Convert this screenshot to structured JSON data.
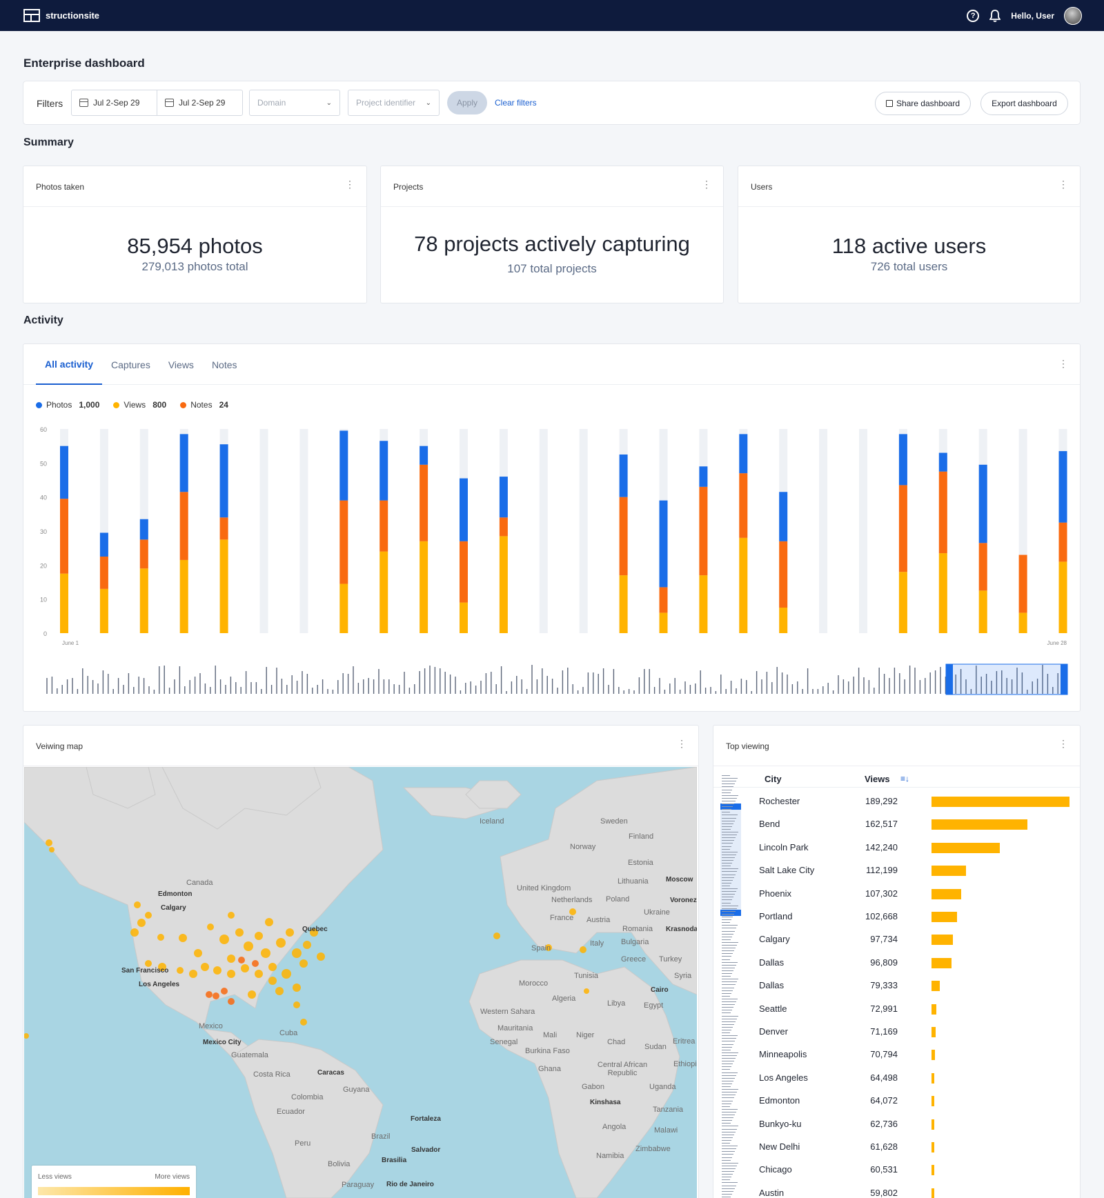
{
  "app": {
    "brand": "structionsite",
    "greeting": "Hello, User",
    "help_icon": "question-circle-icon",
    "bell_icon": "bell-icon"
  },
  "page": {
    "title": "Enterprise dashboard"
  },
  "filters": {
    "label": "Filters",
    "date_from": "Jul 2-Sep 29",
    "date_to": "Jul 2-Sep 29",
    "domain_placeholder": "Domain",
    "project_placeholder": "Project identifier",
    "apply": "Apply",
    "clear": "Clear filters",
    "share": "Share dashboard",
    "export": "Export dashboard"
  },
  "summary": {
    "title": "Summary",
    "cards": [
      {
        "title": "Photos taken",
        "value": "85,954 photos",
        "sub": "279,013 photos total"
      },
      {
        "title": "Projects",
        "value": "78 projects actively capturing",
        "sub": "107 total projects"
      },
      {
        "title": "Users",
        "value": "118 active users",
        "sub": "726 total users"
      }
    ]
  },
  "activity": {
    "title": "Activity",
    "tabs": [
      "All activity",
      "Captures",
      "Views",
      "Notes"
    ],
    "active_tab": "All activity",
    "legend": [
      {
        "name": "Photos",
        "value": "1,000",
        "color": "#1a6de8"
      },
      {
        "name": "Views",
        "value": "800",
        "color": "#ffb300"
      },
      {
        "name": "Notes",
        "value": "24",
        "color": "#f96a10"
      }
    ]
  },
  "chart_data": {
    "type": "bar",
    "stacked": true,
    "y_ticks": [
      "60",
      "50",
      "40",
      "30",
      "20",
      "10",
      "0"
    ],
    "ylim": [
      0,
      60
    ],
    "x_labels": [
      "June 1",
      "June 28"
    ],
    "colors": {
      "Views": "#ffb300",
      "Notes": "#f96a10",
      "Photos": "#1a6de8",
      "empty": "#eef1f5"
    },
    "series": [
      {
        "name": "Views",
        "values": [
          17.5,
          13,
          19,
          21.5,
          27.5,
          0,
          0,
          14.5,
          24,
          27,
          9,
          28.5,
          0,
          0,
          17,
          6,
          17,
          28,
          7.5,
          0,
          0,
          18,
          23.5,
          12.5,
          6,
          21
        ]
      },
      {
        "name": "Notes",
        "values": [
          22,
          9.5,
          8.5,
          20,
          6.5,
          0,
          0,
          24.5,
          15,
          22.5,
          18,
          5.5,
          0,
          0,
          23,
          7.5,
          26,
          19,
          19.5,
          0,
          0,
          25.5,
          24,
          14,
          17,
          11.5
        ]
      },
      {
        "name": "Photos",
        "values": [
          15.5,
          7,
          6,
          17,
          21.5,
          0,
          0,
          20.5,
          17.5,
          5.5,
          18.5,
          12,
          0,
          0,
          12.5,
          25.5,
          6,
          11.5,
          14.5,
          0,
          0,
          15,
          5.5,
          23,
          0,
          21
        ]
      }
    ]
  },
  "map": {
    "title": "Veiwing map",
    "legend_low": "Less views",
    "legend_high": "More views",
    "labels": [
      "Canada",
      "Edmonton",
      "Calgary",
      "Quebec",
      "San Francisco",
      "Los Angeles",
      "Mexico",
      "Mexico City",
      "Cuba",
      "Guatemala",
      "Costa Rica",
      "Caracas",
      "Guyana",
      "Colombia",
      "Ecuador",
      "Peru",
      "Brazil",
      "Fortaleza",
      "Salvador",
      "Brasilia",
      "Bolivia",
      "Paraguay",
      "Rio de Janeiro",
      "Iceland",
      "Sweden",
      "Finland",
      "Norway",
      "Estonia",
      "Lithuania",
      "Moscow",
      "United Kingdom",
      "Netherlands",
      "Poland",
      "France",
      "Austria",
      "Ukraine",
      "Voronezh",
      "Romania",
      "Krasnodar",
      "Bulgaria",
      "Italy",
      "Spain",
      "Greece",
      "Turkey",
      "Syria",
      "Tunisia",
      "Morocco",
      "Algeria",
      "Libya",
      "Cairo",
      "Egypt",
      "Western Sahara",
      "Mauritania",
      "Mali",
      "Niger",
      "Chad",
      "Sudan",
      "Eritrea",
      "Senegal",
      "Burkina Faso",
      "Ghana",
      "Central African Republic",
      "Ethiopia",
      "Gabon",
      "Kinshasa",
      "Uganda",
      "Tanzania",
      "Angola",
      "Malawi",
      "Zimbabwe",
      "Namibia"
    ]
  },
  "top_viewing": {
    "title": "Top viewing",
    "col_city": "City",
    "col_views": "Views",
    "rows": [
      {
        "city": "Rochester",
        "views": "189,292",
        "value": 189292
      },
      {
        "city": "Bend",
        "views": "162,517",
        "value": 162517
      },
      {
        "city": "Lincoln Park",
        "views": "142,240",
        "value": 142240
      },
      {
        "city": "Salt Lake City",
        "views": "112,199",
        "value": 112199
      },
      {
        "city": "Phoenix",
        "views": "107,302",
        "value": 107302
      },
      {
        "city": "Portland",
        "views": "102,668",
        "value": 102668
      },
      {
        "city": "Calgary",
        "views": "97,734",
        "value": 97734
      },
      {
        "city": "Dallas",
        "views": "96,809",
        "value": 96809
      },
      {
        "city": "Dallas",
        "views": "79,333",
        "value": 79333
      },
      {
        "city": "Seattle",
        "views": "72,991",
        "value": 72991
      },
      {
        "city": "Denver",
        "views": "71,169",
        "value": 71169
      },
      {
        "city": "Minneapolis",
        "views": "70,794",
        "value": 70794
      },
      {
        "city": "Los Angeles",
        "views": "64,498",
        "value": 64498
      },
      {
        "city": "Edmonton",
        "views": "64,072",
        "value": 64072
      },
      {
        "city": "Bunkyo-ku",
        "views": "62,736",
        "value": 62736
      },
      {
        "city": "New Delhi",
        "views": "61,628",
        "value": 61628
      },
      {
        "city": "Chicago",
        "views": "60,531",
        "value": 60531
      },
      {
        "city": "Austin",
        "views": "59,802",
        "value": 59802
      }
    ]
  }
}
